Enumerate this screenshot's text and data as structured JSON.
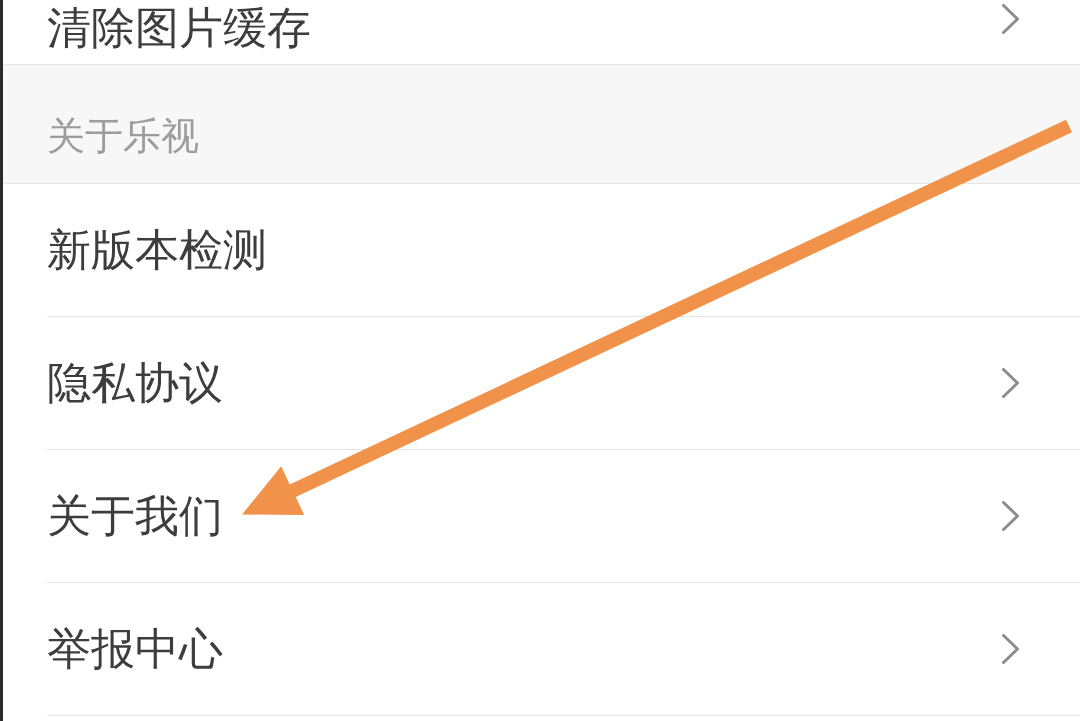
{
  "top_row": {
    "label": "清除图片缓存",
    "chevron": true
  },
  "section": {
    "header": "关于乐视",
    "items": [
      {
        "label": "新版本检测",
        "chevron": false,
        "pointed": false
      },
      {
        "label": "隐私协议",
        "chevron": true,
        "pointed": false
      },
      {
        "label": "关于我们",
        "chevron": true,
        "pointed": true
      },
      {
        "label": "举报中心",
        "chevron": true,
        "pointed": false
      }
    ]
  }
}
